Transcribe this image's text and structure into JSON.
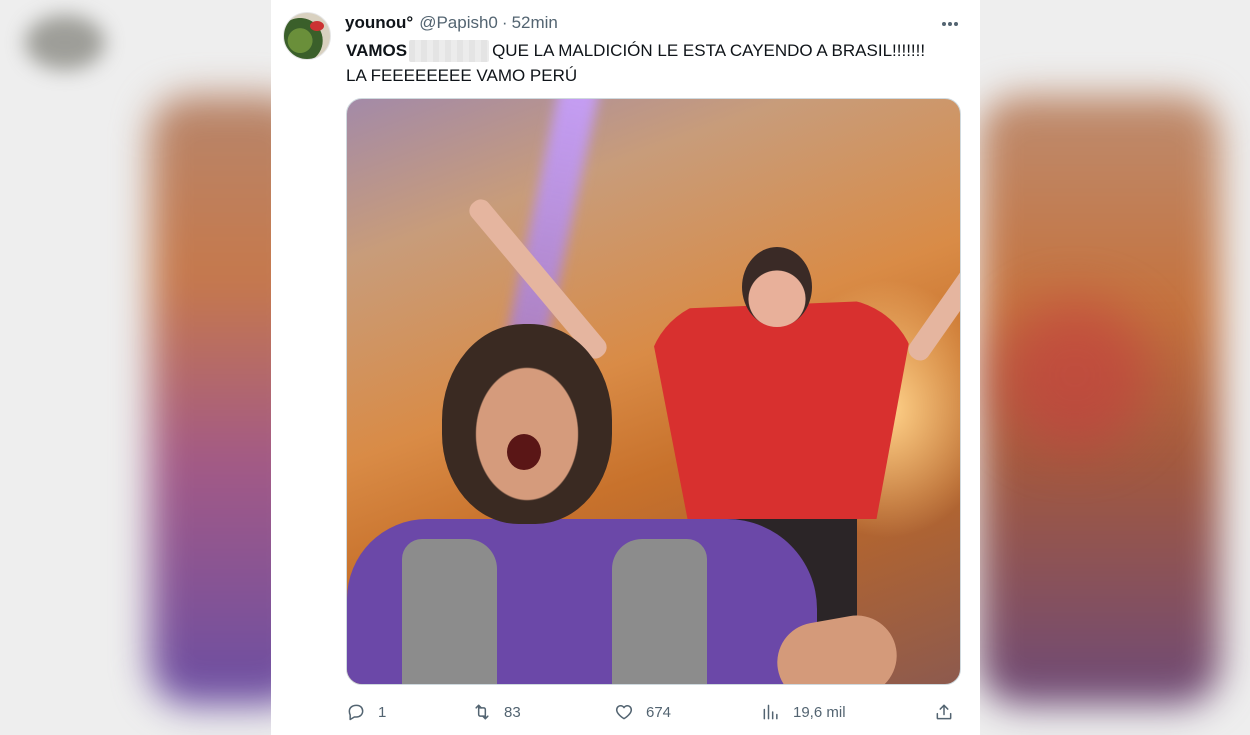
{
  "tweet": {
    "display_name": "younou°",
    "handle": "@Papish0",
    "separator": "·",
    "time": "52min",
    "text_bold": "VAMOS",
    "text_rest": "QUE LA MALDICIÓN LE ESTA CAYENDO A BRASIL!!!!!!!",
    "text_line2": "LA FEEEEEEEE VAMO PERÚ"
  },
  "actions": {
    "reply_count": "1",
    "retweet_count": "83",
    "like_count": "674",
    "views_count": "19,6 mil"
  },
  "icons": {
    "more": "more-horizontal-icon",
    "reply": "reply-icon",
    "retweet": "retweet-icon",
    "like": "heart-icon",
    "views": "views-chart-icon",
    "share": "share-icon"
  },
  "colors": {
    "text_primary": "#0f1419",
    "text_secondary": "#536471",
    "card_bg": "#ffffff"
  }
}
